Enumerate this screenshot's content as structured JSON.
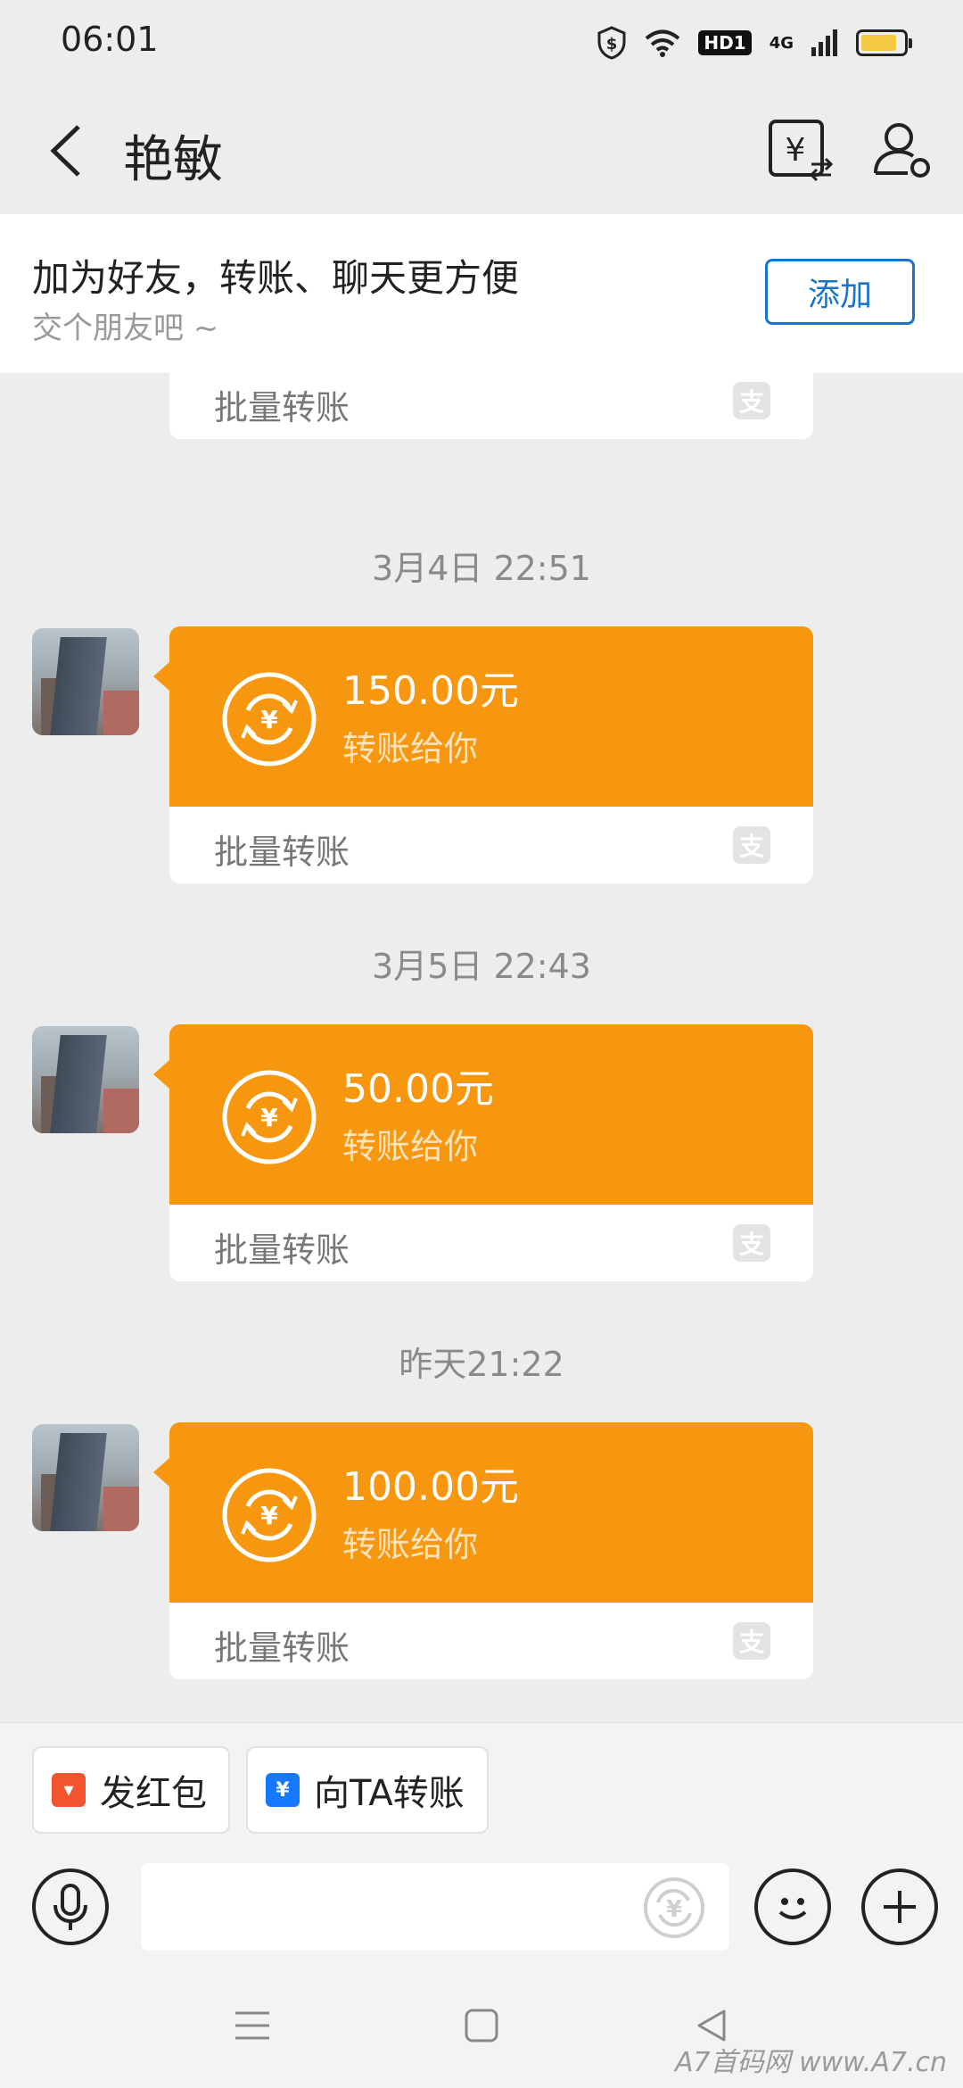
{
  "status_bar": {
    "time": "06:01",
    "hd_label": "HD1",
    "network_label": "4G",
    "icons": [
      "shield-s-icon",
      "wifi-icon",
      "hd-icon",
      "signal-icon",
      "battery-icon"
    ]
  },
  "header": {
    "title": "艳敏",
    "icons": [
      "back-arrow-icon",
      "transfer-record-icon",
      "profile-settings-icon"
    ]
  },
  "banner": {
    "main_text": "加为好友，转账、聊天更方便",
    "sub_text": "交个朋友吧 ~",
    "add_button": "添加"
  },
  "chat": {
    "partial_card": {
      "footer": "批量转账"
    },
    "messages": [
      {
        "timestamp": "3月4日 22:51",
        "amount": "150.00元",
        "desc": "转账给你",
        "footer": "批量转账"
      },
      {
        "timestamp": "3月5日 22:43",
        "amount": "50.00元",
        "desc": "转账给你",
        "footer": "批量转账"
      },
      {
        "timestamp": "昨天21:22",
        "amount": "100.00元",
        "desc": "转账给你",
        "footer": "批量转账"
      }
    ]
  },
  "shortcuts": {
    "red_packet": "发红包",
    "transfer": "向TA转账"
  },
  "input_bar": {
    "icons": [
      "microphone-icon",
      "yen-transfer-icon",
      "emoji-icon",
      "plus-icon"
    ]
  },
  "nav_bar": {
    "icons": [
      "menu-icon",
      "home-square-icon",
      "back-triangle-icon"
    ],
    "watermark": "A7首码网 www.A7.cn"
  },
  "colors": {
    "transfer_orange": "#f7970f",
    "link_blue": "#1a74c9",
    "background": "#ededed",
    "red_packet": "#f2542d",
    "transfer_blue": "#1677ff"
  }
}
